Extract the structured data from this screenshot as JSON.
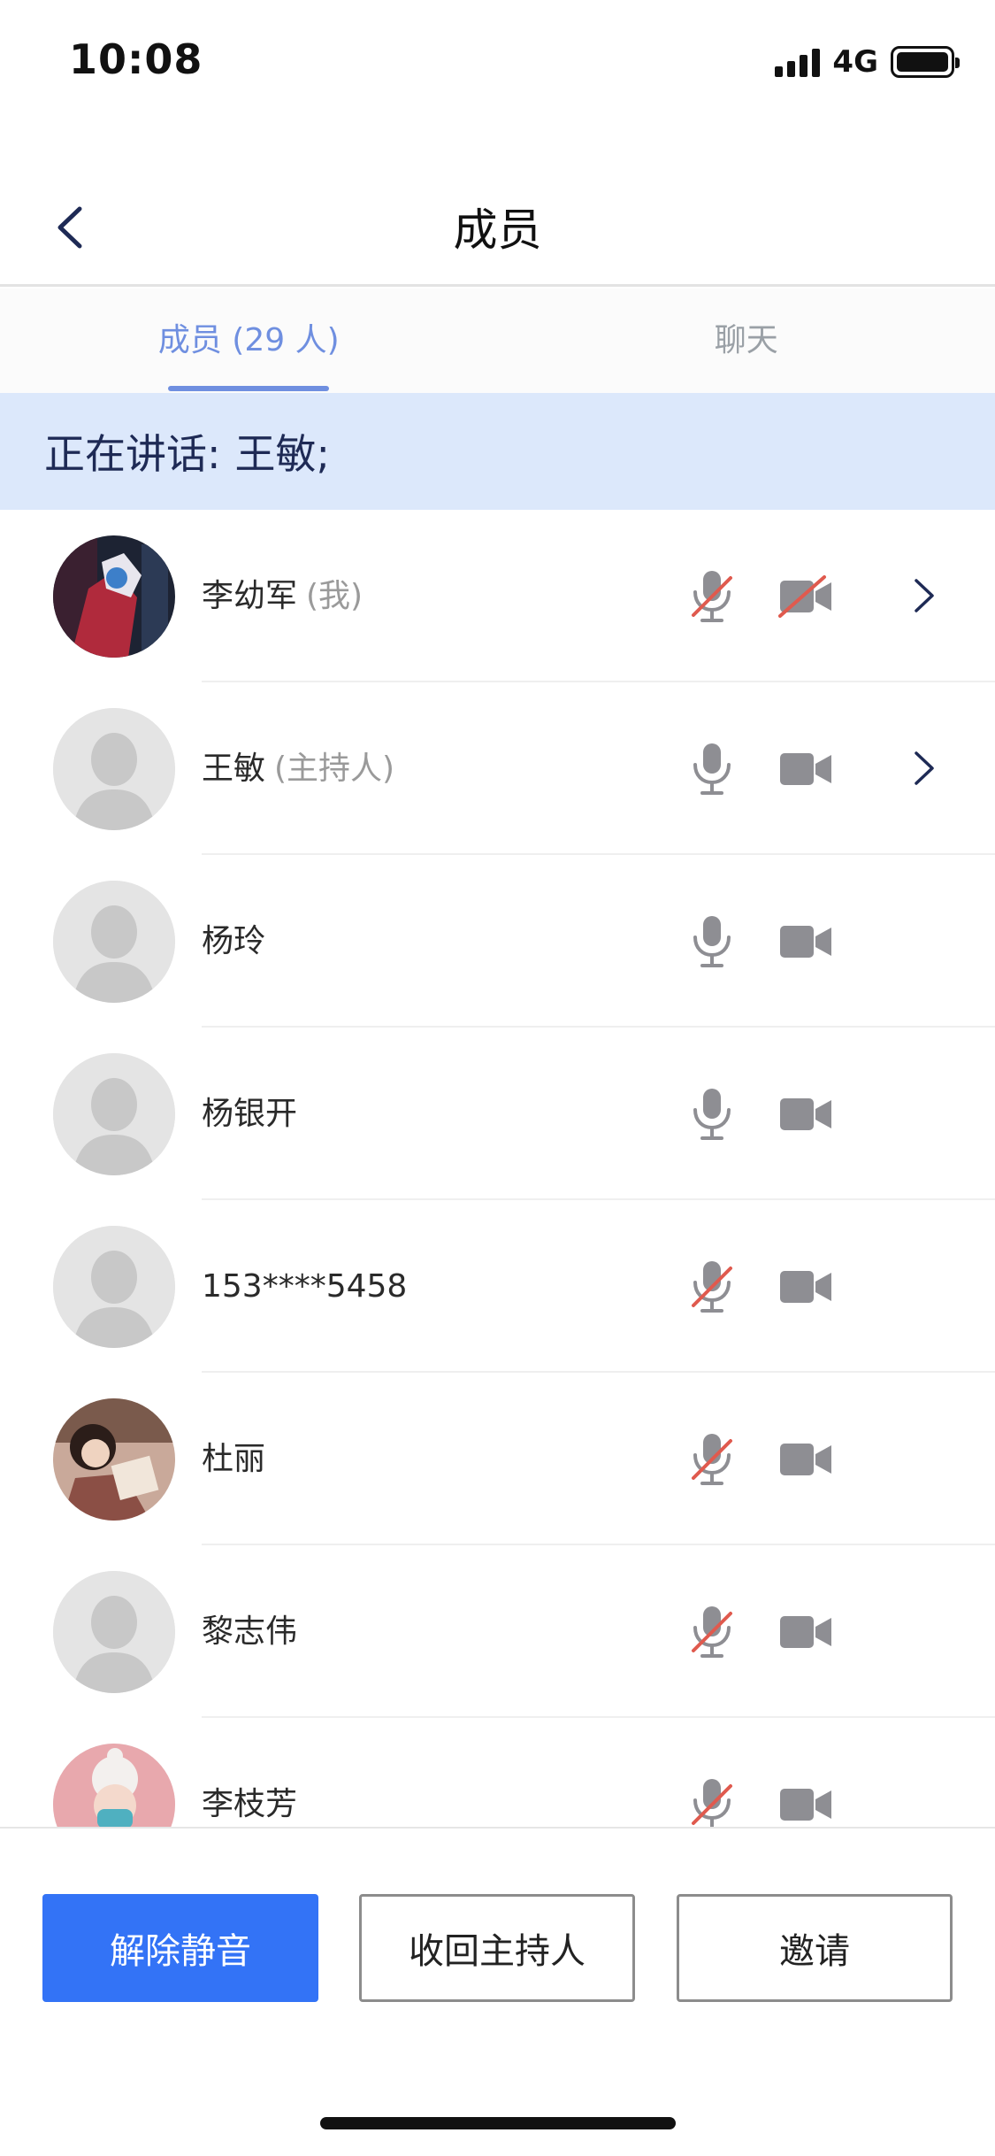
{
  "status_bar": {
    "time": "10:08",
    "network": "4G"
  },
  "nav": {
    "title": "成员"
  },
  "tabs": [
    {
      "label": "成员 (29 人)",
      "active": true
    },
    {
      "label": "聊天",
      "active": false
    }
  ],
  "speaking": {
    "label": "正在讲话:",
    "names": "王敏;"
  },
  "members": [
    {
      "name": "李幼军",
      "role": "(我)",
      "avatar": "photo-dark",
      "mic_muted": true,
      "cam_off": true,
      "chevron": true
    },
    {
      "name": "王敏",
      "role": "(主持人)",
      "avatar": "placeholder",
      "mic_muted": false,
      "cam_off": false,
      "chevron": true
    },
    {
      "name": "杨玲",
      "role": "",
      "avatar": "placeholder",
      "mic_muted": false,
      "cam_off": false,
      "chevron": false
    },
    {
      "name": "杨银开",
      "role": "",
      "avatar": "placeholder",
      "mic_muted": false,
      "cam_off": false,
      "chevron": false
    },
    {
      "name": "153****5458",
      "role": "",
      "avatar": "placeholder",
      "mic_muted": true,
      "cam_off": false,
      "chevron": false
    },
    {
      "name": "杜丽",
      "role": "",
      "avatar": "photo-brown",
      "mic_muted": true,
      "cam_off": false,
      "chevron": false
    },
    {
      "name": "黎志伟",
      "role": "",
      "avatar": "placeholder",
      "mic_muted": true,
      "cam_off": false,
      "chevron": false
    },
    {
      "name": "李枝芳",
      "role": "",
      "avatar": "photo-pink",
      "mic_muted": true,
      "cam_off": false,
      "chevron": false
    }
  ],
  "actions": {
    "unmute_label": "解除静音",
    "revoke_host_label": "收回主持人",
    "invite_label": "邀请"
  },
  "colors": {
    "accent": "#3373f6",
    "tab_active": "#6f8fe0",
    "banner_bg": "#dce8fb",
    "muted_red": "#e05a4e",
    "icon_gray": "#8e8e93"
  },
  "icons": {
    "back": "chevron-left-icon",
    "mic": "microphone-icon",
    "cam": "video-camera-icon",
    "chevron": "chevron-right-icon"
  }
}
